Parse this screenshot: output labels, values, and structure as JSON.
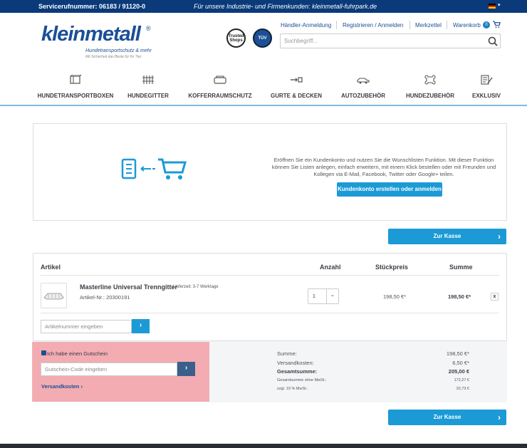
{
  "topbar": {
    "phone": "Servicerufnummer: 06183 / 91120-0",
    "promo": "Für unsere Industrie- und Firmenkunden: kleinmetall-fuhrpark.de"
  },
  "logo": {
    "brand": "kleinmetall",
    "reg": "®",
    "tagline": "Hundetransportschutz & mehr",
    "subtagline": "Mit Sicherheit das Beste für Ihr Tier."
  },
  "seals": [
    "Trusted Shops",
    "TÜV"
  ],
  "header": {
    "links": [
      "Händler-Anmeldung",
      "Registrieren / Anmelden",
      "Merkzettel",
      "Warenkorb"
    ],
    "cart_count": "0",
    "search_placeholder": "Suchbegriff..."
  },
  "nav": [
    {
      "label": "HUNDETRANSPORTBOXEN",
      "icon": "box-icon"
    },
    {
      "label": "HUNDEGITTER",
      "icon": "grid-icon"
    },
    {
      "label": "KOFFERRAUMSCHUTZ",
      "icon": "trunk-icon"
    },
    {
      "label": "GURTE & DECKEN",
      "icon": "belt-icon"
    },
    {
      "label": "AUTOZUBEHÖR",
      "icon": "car-icon"
    },
    {
      "label": "HUNDEZUBEHÖR",
      "icon": "bone-icon"
    },
    {
      "label": "EXKLUSIV",
      "icon": "exclusive-icon"
    }
  ],
  "promo": {
    "text": "Eröffnen Sie ein Kundenkonto und nutzen Sie die Wunschlisten Funktion. Mit dieser Funktion können Sie Listen anlegen, einfach erweitern, mit einem Klick bestellen oder mit Freunden und Kollegen via E-Mail, Facebook, Twitter oder Google+ teilen.",
    "button": "Kundenkonto erstellen oder anmelden"
  },
  "checkout_label": "Zur Kasse",
  "cart": {
    "headers": {
      "article": "Artikel",
      "qty": "Anzahl",
      "unit": "Stückpreis",
      "sum": "Summe"
    },
    "item": {
      "name": "Masterline Universal Trenngitter",
      "delivery": "Lieferzeit: 3-7 Werktage",
      "article_nr": "Artikel-Nr.: 20300191",
      "qty": "1",
      "unit_price": "198,50 €*",
      "total": "198,50 €*",
      "remove": "x"
    },
    "article_input_placeholder": "Artikelnummer eingeben"
  },
  "voucher": {
    "checkbox_label": "Ich habe einen Gutschein",
    "placeholder": "Gutschein-Code eingeben",
    "shipping_link": "Versandkosten"
  },
  "summary": [
    {
      "label": "Summe:",
      "value": "198,50 €*"
    },
    {
      "label": "Versandkosten:",
      "value": "6,50 €*"
    },
    {
      "label": "Gesamtsumme:",
      "value": "205,00 €"
    },
    {
      "label": "Gesamtsumme ohne MwSt.:",
      "value": "172,27 €"
    },
    {
      "label": "zzgl. 19 % MwSt.:",
      "value": "32,73 €"
    }
  ],
  "colors": {
    "primary": "#1c4f96",
    "accent": "#1c9ad6",
    "topbar": "#0a3a7a"
  }
}
